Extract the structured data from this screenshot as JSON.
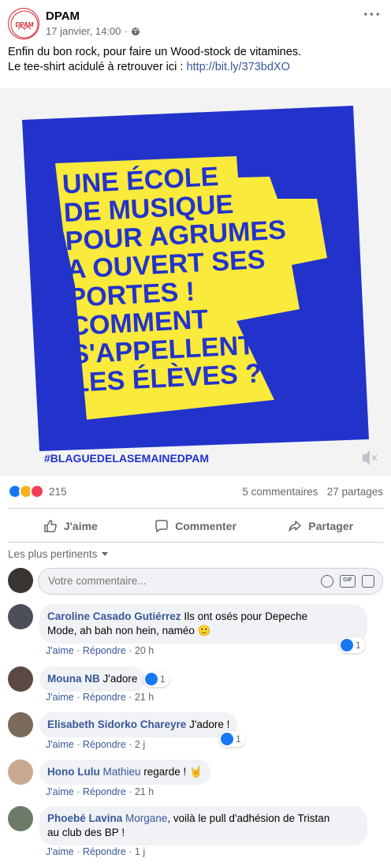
{
  "post": {
    "page_name": "DPAM",
    "timestamp": "17 janvier, 14:00",
    "privacy_separator": "·",
    "text_line1": "Enfin du bon rock, pour faire un Wood-stock de vitamines.",
    "text_line2_prefix": "Le tee-shirt acidulé à retrouver ici : ",
    "link": "http://bit.ly/373bdXO",
    "logo_text": "DPAM"
  },
  "image": {
    "lines": [
      "UNE ÉCOLE",
      "DE MUSIQUE",
      "POUR AGRUMES",
      "A OUVERT SES",
      "PORTES !",
      "COMMENT",
      "S'APPELLENT",
      "LES ÉLÈVES ?"
    ],
    "hashtag": "#BLAGUEDELASEMAINEDPAM",
    "bg_color": "#2233cc",
    "text_bg_color": "#f9ea3c",
    "text_color": "#2233cc"
  },
  "stats": {
    "reaction_count": "215",
    "comments": "5 commentaires",
    "shares": "27 partages"
  },
  "actions": {
    "like": "J'aime",
    "comment": "Commenter",
    "share": "Partager"
  },
  "sort_label": "Les plus pertinents",
  "composer": {
    "placeholder": "Votre commentaire...",
    "gif_label": "GIF"
  },
  "comments": [
    {
      "author": "Caroline Casado Gutiérrez",
      "text": " Ils ont osés pour Depeche",
      "text2": "Mode, ah bah non hein, naméo",
      "emoji": "🙂",
      "like": "J'aime",
      "reply": "Répondre",
      "time": "20 h",
      "reactions": "1"
    },
    {
      "author": "Mouna NB",
      "text": " J'adore",
      "like": "J'aime",
      "reply": "Répondre",
      "time": "21 h",
      "reactions": "1"
    },
    {
      "author": "Elisabeth Sidorko Chareyre",
      "text": " J'adore !",
      "like": "J'aime",
      "reply": "Répondre",
      "time": "2 j",
      "reactions": "1"
    },
    {
      "author": "Hono Lulu",
      "tag": " Mathieu",
      "text": " regarde ! ",
      "emoji": "🤘",
      "like": "J'aime",
      "reply": "Répondre",
      "time": "21 h"
    },
    {
      "author": "Phoebé Lavina",
      "tag": " Morgane",
      "text": ", voilà le pull d'adhésion de Tristan",
      "text2": "au club des BP !",
      "like": "J'aime",
      "reply": "Répondre",
      "time": "1 j"
    }
  ],
  "link_separator": "·",
  "colors": {
    "link": "#385898",
    "secondary": "#65676b",
    "like_blue": "#1877f2",
    "haha_yellow": "#f7b125",
    "love_red": "#f33e58"
  }
}
